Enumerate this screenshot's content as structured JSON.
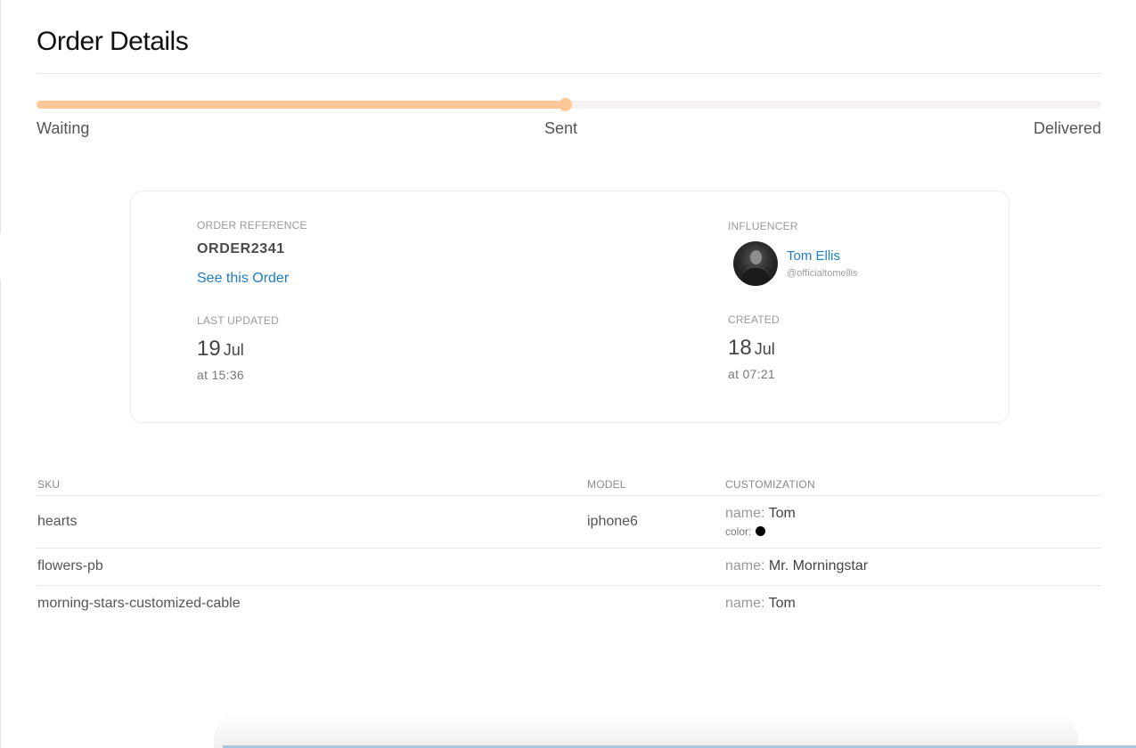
{
  "page": {
    "title": "Order Details"
  },
  "progress": {
    "fraction": 0.496,
    "steps": [
      {
        "label": "Waiting"
      },
      {
        "label": "Sent"
      },
      {
        "label": "Delivered"
      }
    ],
    "fill_color": "#fdc896",
    "track_color": "#f6f2f2"
  },
  "order": {
    "reference_caption": "ORDER REFERENCE",
    "reference": "ORDER2341",
    "see_link": "See this Order",
    "last_updated_caption": "LAST UPDATED",
    "last_updated_day": "19",
    "last_updated_month": "Jul",
    "last_updated_time": "at 15:36",
    "created_caption": "CREATED",
    "created_day": "18",
    "created_month": "Jul",
    "created_time": "at 07:21"
  },
  "influencer": {
    "caption": "INFLUENCER",
    "name": "Tom Ellis",
    "handle": "@officialtomellis",
    "link_color": "#1e7dc4"
  },
  "table": {
    "headers": {
      "sku": "SKU",
      "model": "MODEL",
      "customization": "CUSTOMIZATION"
    },
    "rows": [
      {
        "sku": "hearts",
        "model": "iphone6",
        "name_key": "name:",
        "name_value": "Tom",
        "color_key": "color:",
        "color_value": "#000000"
      },
      {
        "sku": "flowers-pb",
        "model": "",
        "name_key": "name:",
        "name_value": "Mr. Morningstar"
      },
      {
        "sku": "morning-stars-customized-cable",
        "model": "",
        "name_key": "name:",
        "name_value": "Tom"
      }
    ]
  }
}
